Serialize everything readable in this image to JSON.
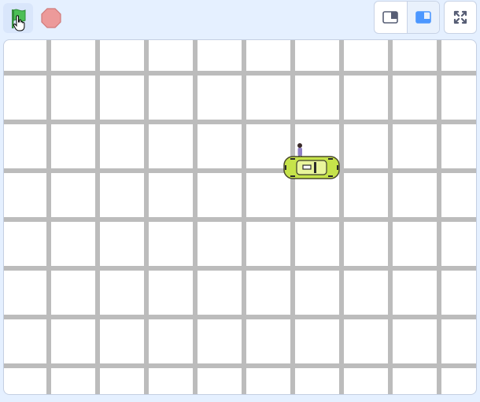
{
  "toolbar": {
    "green_flag_icon": "green-flag-icon",
    "stop_icon": "stop-sign-icon",
    "small_stage_icon": "small-stage-layout-icon",
    "large_stage_icon": "large-stage-layout-icon",
    "fullscreen_icon": "fullscreen-icon"
  },
  "stage": {
    "background": "#ffffff",
    "grid_color": "#bcbcbc",
    "sprites": [
      {
        "name": "taxi-car",
        "color": "#c6e34a"
      },
      {
        "name": "person",
        "color": "#8f7fc4"
      }
    ]
  },
  "colors": {
    "accent": "#4c97ff",
    "toolbar_bg": "#e5f0ff",
    "flag_green": "#4cbf56",
    "stop_red": "#ec9a9a"
  }
}
